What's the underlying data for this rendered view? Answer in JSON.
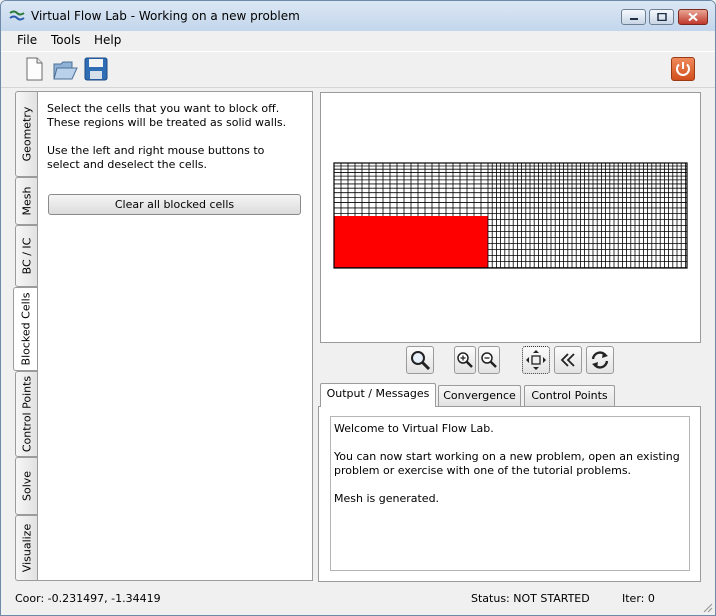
{
  "window": {
    "title": "Virtual Flow Lab - Working on a new problem"
  },
  "menu": {
    "items": [
      {
        "label": "File"
      },
      {
        "label": "Tools"
      },
      {
        "label": "Help"
      }
    ]
  },
  "toolbar": {
    "icons": [
      "new-file-icon",
      "open-folder-icon",
      "save-disk-icon",
      "power-icon"
    ]
  },
  "left_tabs": [
    {
      "label": "Geometry"
    },
    {
      "label": "Mesh"
    },
    {
      "label": "BC / IC"
    },
    {
      "label": "Blocked Cells",
      "active": true
    },
    {
      "label": "Control Points"
    },
    {
      "label": "Solve"
    },
    {
      "label": "Visualize"
    }
  ],
  "blocked_cells": {
    "instruction_1": "Select the cells that you want to block off. These regions will be treated as solid walls.",
    "instruction_2": "Use the left and right mouse buttons to select and deselect the cells.",
    "clear_button": "Clear all blocked cells"
  },
  "mesh": {
    "block_color": "#ff0000",
    "grid_color": "#000000"
  },
  "view_tools": {
    "icons": [
      "zoom-icon",
      "zoom-in-icon",
      "zoom-out-icon",
      "pan-icon",
      "rewind-icon",
      "refresh-icon"
    ]
  },
  "bottom_tabs": [
    {
      "label": "Output / Messages",
      "active": true
    },
    {
      "label": "Convergence"
    },
    {
      "label": "Control Points"
    }
  ],
  "messages": [
    "Welcome to Virtual Flow Lab.",
    "You can now start working on a new problem, open an existing problem or exercise with one of the tutorial problems.",
    "Mesh is generated."
  ],
  "status": {
    "coor": "Coor: -0.231497, -1.34419",
    "status": "Status: NOT STARTED",
    "iter": "Iter: 0"
  }
}
